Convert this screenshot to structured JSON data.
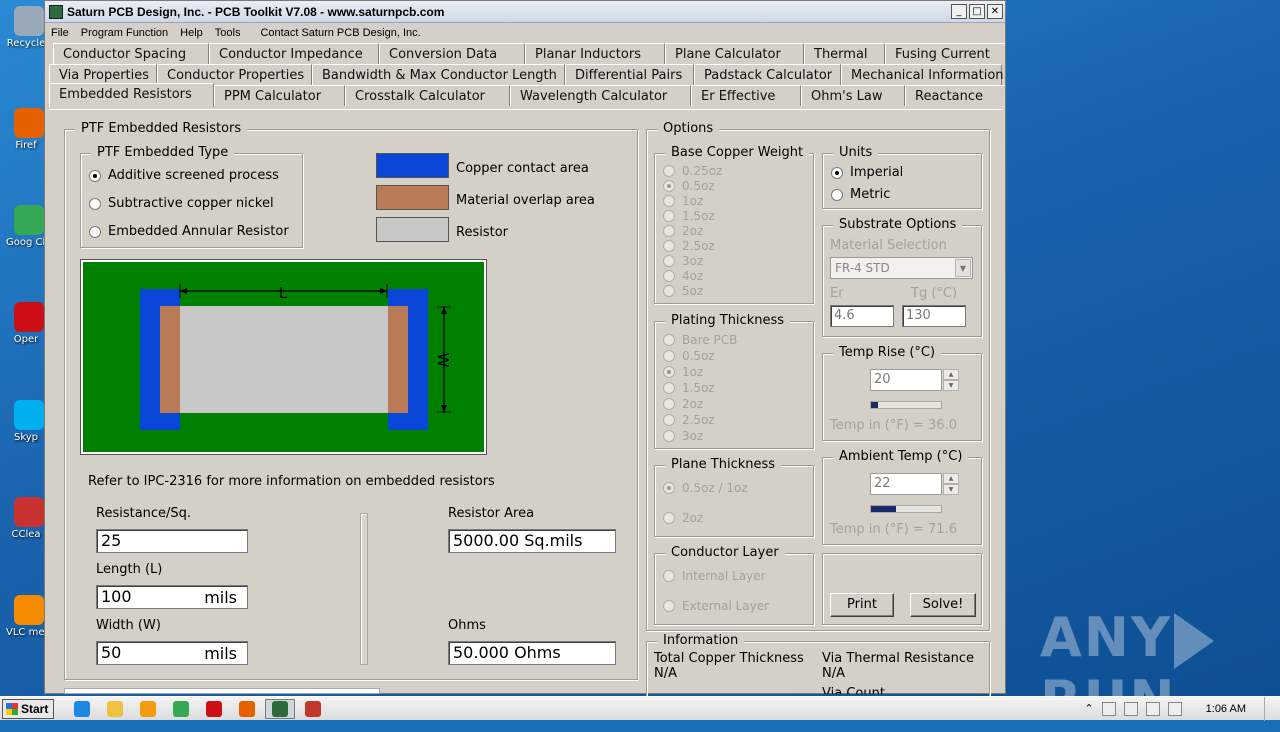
{
  "desktop": {
    "icons": [
      {
        "label": "Recycle",
        "color": "#9aa9b8"
      },
      {
        "label": "Firef",
        "color": "#e66000"
      },
      {
        "label": "Goog Chron",
        "color": "#34a853"
      },
      {
        "label": "Oper",
        "color": "#cc0f16"
      },
      {
        "label": "Skyp",
        "color": "#00aff0"
      },
      {
        "label": "CClea",
        "color": "#c8312f"
      },
      {
        "label": "VLC me playe",
        "color": "#f48b00"
      }
    ],
    "watermark": {
      "left": "ANY",
      "right": "RUN"
    }
  },
  "window": {
    "title": "Saturn PCB Design, Inc. - PCB Toolkit V7.08 - www.saturnpcb.com",
    "controls": {
      "minimize": "_",
      "maximize": "□",
      "close": "✕"
    },
    "menu": [
      "File",
      "Program Function",
      "Help",
      "Tools",
      "Contact Saturn PCB Design, Inc."
    ]
  },
  "tabs": {
    "row1": [
      "Conductor Spacing",
      "Conductor Impedance",
      "Conversion Data",
      "Planar Inductors",
      "Plane Calculator",
      "Thermal",
      "Fusing Current"
    ],
    "row2": [
      "Via Properties",
      "Conductor Properties",
      "Bandwidth & Max Conductor Length",
      "Differential Pairs",
      "Padstack Calculator",
      "Mechanical Information"
    ],
    "row3": [
      "Embedded Resistors",
      "PPM Calculator",
      "Crosstalk Calculator",
      "Wavelength Calculator",
      "Er Effective",
      "Ohm's Law",
      "Reactance"
    ]
  },
  "ptf": {
    "title": "PTF Embedded Resistors",
    "type_title": "PTF Embedded Type",
    "types": [
      {
        "label": "Additive screened process",
        "checked": true
      },
      {
        "label": "Subtractive copper nickel",
        "checked": false
      },
      {
        "label": "Embedded Annular Resistor",
        "checked": false
      }
    ],
    "legend": [
      {
        "label": "Copper contact area",
        "color": "#0a47d9"
      },
      {
        "label": "Material overlap area",
        "color": "#b97a57"
      },
      {
        "label": "Resistor",
        "color": "#c8c8c8"
      }
    ],
    "diagram": {
      "length_label": "L",
      "width_label": "W"
    },
    "refer_text": "Refer to IPC-2316 for more information on embedded resistors",
    "fields": {
      "resistance_label": "Resistance/Sq.",
      "resistance_value": "25",
      "length_label": "Length (L)",
      "length_value": "100",
      "length_unit": "mils",
      "width_label": "Width (W)",
      "width_value": "50",
      "width_unit": "mils"
    },
    "results": {
      "area_label": "Resistor Area",
      "area_value": "5000.00 Sq.mils",
      "ohms_label": "Ohms",
      "ohms_value": "50.000 Ohms"
    }
  },
  "options": {
    "title": "Options",
    "base_copper": {
      "title": "Base Copper Weight",
      "items": [
        {
          "label": "0.25oz",
          "checked": false
        },
        {
          "label": "0.5oz",
          "checked": true
        },
        {
          "label": "1oz",
          "checked": false
        },
        {
          "label": "1.5oz",
          "checked": false
        },
        {
          "label": "2oz",
          "checked": false
        },
        {
          "label": "2.5oz",
          "checked": false
        },
        {
          "label": "3oz",
          "checked": false
        },
        {
          "label": "4oz",
          "checked": false
        },
        {
          "label": "5oz",
          "checked": false
        }
      ]
    },
    "plating": {
      "title": "Plating Thickness",
      "items": [
        {
          "label": "Bare PCB",
          "checked": false
        },
        {
          "label": "0.5oz",
          "checked": false
        },
        {
          "label": "1oz",
          "checked": true
        },
        {
          "label": "1.5oz",
          "checked": false
        },
        {
          "label": "2oz",
          "checked": false
        },
        {
          "label": "2.5oz",
          "checked": false
        },
        {
          "label": "3oz",
          "checked": false
        }
      ]
    },
    "plane": {
      "title": "Plane Thickness",
      "items": [
        {
          "label": "0.5oz / 1oz",
          "checked": true
        },
        {
          "label": "2oz",
          "checked": false
        }
      ]
    },
    "conductor_layer": {
      "title": "Conductor Layer",
      "items": [
        {
          "label": "Internal Layer",
          "checked": false
        },
        {
          "label": "External Layer",
          "checked": false
        }
      ]
    },
    "units": {
      "title": "Units",
      "items": [
        {
          "label": "Imperial",
          "checked": true
        },
        {
          "label": "Metric",
          "checked": false
        }
      ]
    },
    "substrate": {
      "title": "Substrate Options",
      "material_label": "Material Selection",
      "material_value": "FR-4 STD",
      "er_label": "Er",
      "er_value": "4.6",
      "tg_label": "Tg (°C)",
      "tg_value": "130"
    },
    "temp_rise": {
      "title": "Temp Rise (°C)",
      "value": "20",
      "level": 0.1,
      "readout": "Temp in (°F) = 36.0"
    },
    "ambient": {
      "title": "Ambient Temp (°C)",
      "value": "22",
      "level": 0.35,
      "readout": "Temp in (°F) = 71.6"
    },
    "buttons": {
      "print": "Print",
      "solve": "Solve!"
    }
  },
  "information": {
    "title": "Information",
    "total_copper_label": "Total Copper Thickness",
    "total_copper_value": "N/A",
    "via_thermal_label": "Via Thermal Resistance",
    "via_thermal_value": "N/A",
    "via_count_label": "Via Count"
  },
  "taskbar": {
    "start": "Start",
    "apps": [
      {
        "name": "ie",
        "color": "#1e88e5"
      },
      {
        "name": "explorer",
        "color": "#f0c040"
      },
      {
        "name": "media",
        "color": "#f39c12"
      },
      {
        "name": "chrome",
        "color": "#34a853"
      },
      {
        "name": "opera",
        "color": "#cc0f16"
      },
      {
        "name": "firefox",
        "color": "#e66000"
      },
      {
        "name": "pcb-toolkit",
        "color": "#2f6b3a"
      },
      {
        "name": "acrobat",
        "color": "#c0392b"
      }
    ],
    "time": "1:06 AM"
  }
}
